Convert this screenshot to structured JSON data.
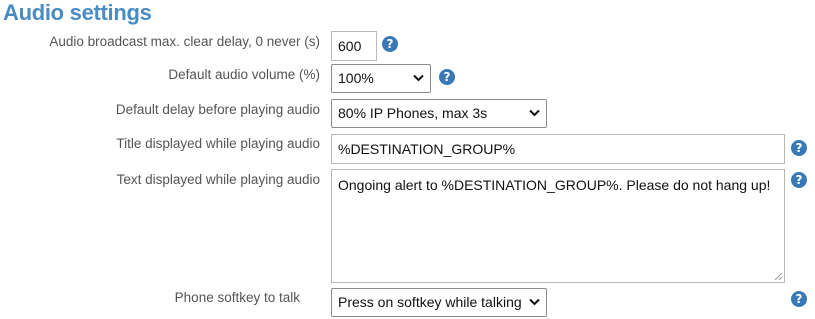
{
  "section": {
    "title": "Audio settings"
  },
  "rows": {
    "max_clear_delay": {
      "label": "Audio broadcast max. clear delay, 0 never (s)",
      "value": "600"
    },
    "default_volume": {
      "label": "Default audio volume (%)",
      "value": "100%"
    },
    "default_delay": {
      "label": "Default delay before playing audio",
      "value": "80% IP Phones, max 3s"
    },
    "title_displayed": {
      "label": "Title displayed while playing audio",
      "value": "%DESTINATION_GROUP%"
    },
    "text_displayed": {
      "label": "Text displayed while playing audio",
      "value": "Ongoing alert to %DESTINATION_GROUP%. Please do not hang up!"
    },
    "softkey": {
      "label": "Phone softkey to talk",
      "value": "Press on softkey while talking"
    }
  },
  "help_glyph": "?",
  "icons": {
    "help": "help-circle-icon",
    "dropdown": "chevron-down-icon",
    "resize": "resize-grip-icon"
  },
  "colors": {
    "title": "#4a8bc2",
    "help": "#3b79b6"
  }
}
